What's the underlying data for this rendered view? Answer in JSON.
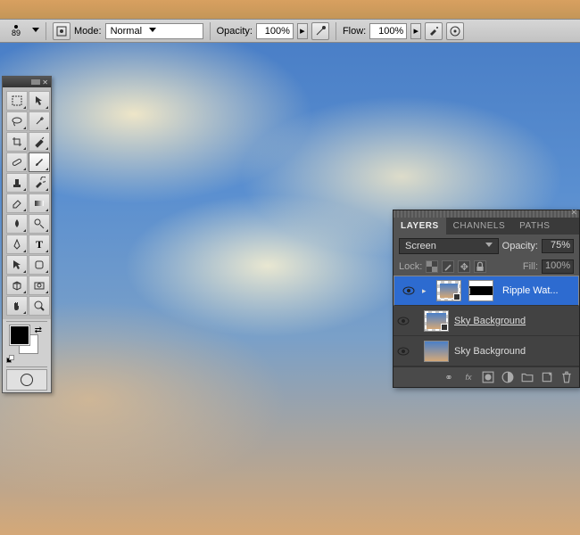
{
  "options_bar": {
    "brush_size": "89",
    "mode_label": "Mode:",
    "mode_value": "Normal",
    "opacity_label": "Opacity:",
    "opacity_value": "100%",
    "flow_label": "Flow:",
    "flow_value": "100%"
  },
  "tools": {
    "items": [
      {
        "name": "move-tool"
      },
      {
        "name": "marquee-tool"
      },
      {
        "name": "lasso-tool"
      },
      {
        "name": "magic-wand-tool"
      },
      {
        "name": "crop-tool"
      },
      {
        "name": "eyedropper-tool"
      },
      {
        "name": "healing-brush-tool"
      },
      {
        "name": "brush-tool",
        "active": true
      },
      {
        "name": "clone-stamp-tool"
      },
      {
        "name": "history-brush-tool"
      },
      {
        "name": "eraser-tool"
      },
      {
        "name": "gradient-tool"
      },
      {
        "name": "blur-tool"
      },
      {
        "name": "dodge-tool"
      },
      {
        "name": "pen-tool"
      },
      {
        "name": "type-tool"
      },
      {
        "name": "path-selection-tool"
      },
      {
        "name": "shape-tool"
      },
      {
        "name": "3d-tool"
      },
      {
        "name": "hand-tool"
      },
      {
        "name": "hand-tool-2"
      },
      {
        "name": "zoom-tool"
      }
    ],
    "foreground_color": "#000000",
    "background_color": "#ffffff"
  },
  "layers_panel": {
    "tabs": {
      "layers": "LAYERS",
      "channels": "CHANNELS",
      "paths": "PATHS"
    },
    "active_tab": "LAYERS",
    "blend_mode": "Screen",
    "opacity_label": "Opacity:",
    "opacity_value": "75%",
    "lock_label": "Lock:",
    "fill_label": "Fill:",
    "fill_value": "100%",
    "layers": [
      {
        "name": "Ripple Wat...",
        "selected": true,
        "visible": true,
        "has_mask": true,
        "smart": true
      },
      {
        "name": "Sky Background",
        "selected": false,
        "visible": true,
        "underline": true,
        "smart": true
      },
      {
        "name": "Sky Background",
        "selected": false,
        "visible": true
      }
    ],
    "footer_icons": [
      "link",
      "fx",
      "mask",
      "adjustment",
      "group",
      "new",
      "trash"
    ]
  }
}
